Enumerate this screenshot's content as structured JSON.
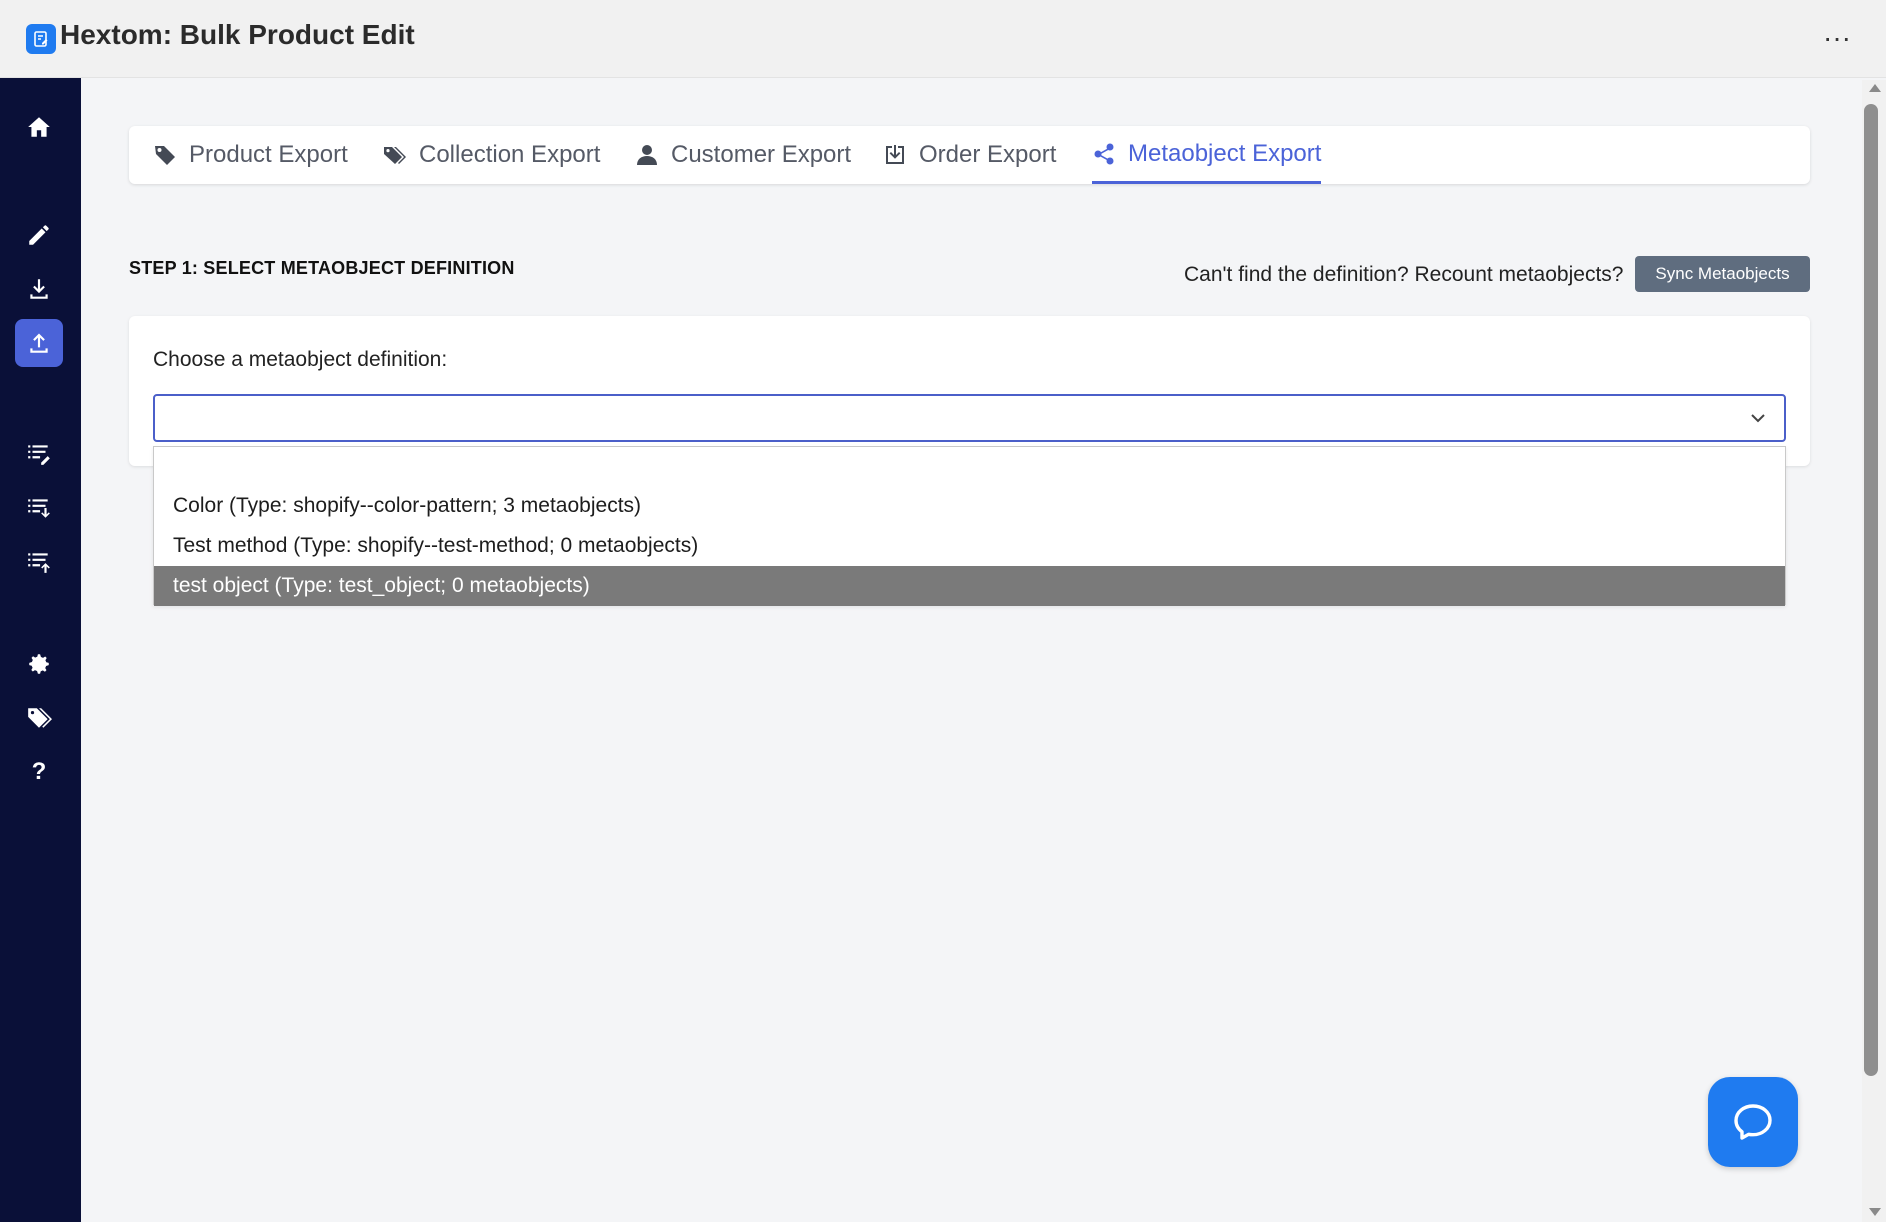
{
  "app": {
    "title": "Hextom: Bulk Product Edit",
    "logo_icon": "edit-document-icon",
    "more_label": "···"
  },
  "sidebar": {
    "items": [
      {
        "icon": "home-icon",
        "active": false
      },
      {
        "icon": "pencil-icon",
        "active": false
      },
      {
        "icon": "download-icon",
        "active": false
      },
      {
        "icon": "upload-icon",
        "active": true
      },
      {
        "icon": "list-edit-icon",
        "active": false
      },
      {
        "icon": "list-download-icon",
        "active": false
      },
      {
        "icon": "list-upload-icon",
        "active": false
      },
      {
        "icon": "gear-icon",
        "active": false
      },
      {
        "icon": "tags-icon",
        "active": false
      },
      {
        "icon": "help-icon",
        "active": false,
        "label": "?"
      }
    ]
  },
  "tabs": [
    {
      "label": "Product Export",
      "icon": "tag-icon",
      "active": false
    },
    {
      "label": "Collection Export",
      "icon": "tags-icon",
      "active": false
    },
    {
      "label": "Customer Export",
      "icon": "user-icon",
      "active": false
    },
    {
      "label": "Order Export",
      "icon": "download-box-icon",
      "active": false
    },
    {
      "label": "Metaobject Export",
      "icon": "share-nodes-icon",
      "active": true
    }
  ],
  "step": {
    "heading": "STEP 1: SELECT METAOBJECT DEFINITION",
    "recount_text": "Can't find the definition? Recount metaobjects?",
    "sync_button": "Sync Metaobjects"
  },
  "definition": {
    "label": "Choose a metaobject definition:",
    "selected_value": "",
    "options": [
      {
        "label": "",
        "selected": false
      },
      {
        "label": "Color (Type: shopify--color-pattern; 3 metaobjects)",
        "selected": false
      },
      {
        "label": "Test method (Type: shopify--test-method; 0 metaobjects)",
        "selected": false
      },
      {
        "label": "test object (Type: test_object; 0 metaobjects)",
        "selected": true
      }
    ]
  },
  "colors": {
    "accent": "#4b63d8",
    "sidebar_bg": "#0a1038",
    "chat_button": "#1f7bf0",
    "highlight_option": "#7a7a7a"
  }
}
